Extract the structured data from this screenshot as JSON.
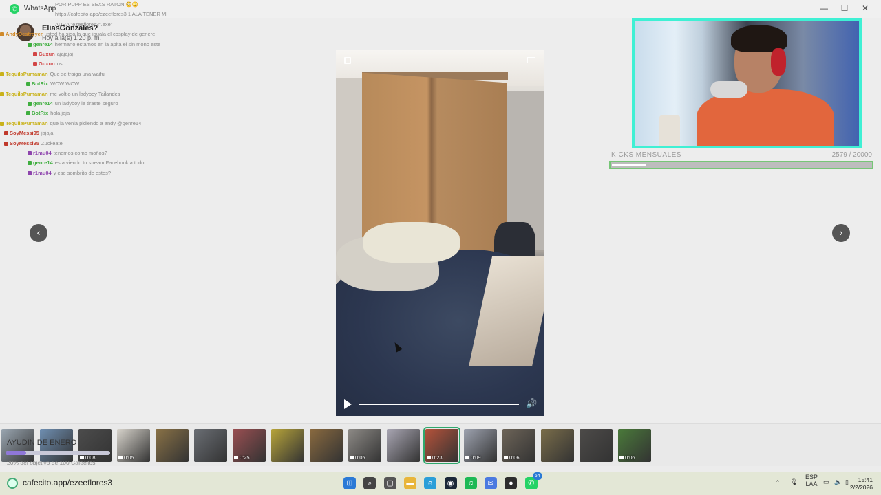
{
  "app": {
    "title": "WhatsApp"
  },
  "window": {
    "minimize": "—",
    "maximize": "☐",
    "close": "✕"
  },
  "contact": {
    "name": "EliasGonzales?",
    "time": "Hoy a la(s) 1:20 p. m."
  },
  "navigation": {
    "prev": "‹",
    "next": "›"
  },
  "kicks": {
    "label": "KICKS MENSUALES",
    "current": "2579",
    "goal": "/ 20000",
    "progress": 0.129
  },
  "chat": [
    {
      "user": "",
      "text": "POR PUPP ES SEXS RATON 😳😳",
      "color": "#9a9a9a"
    },
    {
      "user": "",
      "text": "https://cafecito.app/ezeeflores3 1 ALA TENER MI",
      "color": "#9a9a9a"
    },
    {
      "user": "",
      "text": "AURA \"ezeeflores3\".exe\"",
      "color": "#9a9a9a"
    },
    {
      "user": "AndyDestroyer",
      "text": "usted ha sido la que iguala el cosplay de genere",
      "color": "#d08a2a"
    },
    {
      "user": "genre14",
      "text": "hermano estamos en la apita el sin mono este",
      "color": "#3fae3f"
    },
    {
      "user": "Guxun",
      "text": "ajajajaj",
      "color": "#d24545"
    },
    {
      "user": "Guxun",
      "text": "osi",
      "color": "#d24545"
    },
    {
      "user": "TequilaPumaman",
      "text": "Que se traiga una waifu",
      "color": "#c9b21a"
    },
    {
      "user": "BotRix",
      "text": "WOW WOW",
      "color": "#3fae3f"
    },
    {
      "user": "TequilaPumaman",
      "text": "me voltio un ladyboy Tailandes",
      "color": "#c9b21a"
    },
    {
      "user": "genre14",
      "text": "un ladyboy le tiraste seguro",
      "color": "#3fae3f"
    },
    {
      "user": "BotRix",
      "text": "hola jaja",
      "color": "#3fae3f"
    },
    {
      "user": "TequilaPumaman",
      "text": "que la venia pidiendo a andy @genre14",
      "color": "#c9b21a"
    },
    {
      "user": "SoyMessi95",
      "text": "jajaja",
      "color": "#c0392b"
    },
    {
      "user": "SoyMessi95",
      "text": "Zuckeate",
      "color": "#c0392b"
    },
    {
      "user": "r1mu04",
      "text": "tenemos como moños?",
      "color": "#8e44ad"
    },
    {
      "user": "genre14",
      "text": "esta viendo tu stream Facebook a todo",
      "color": "#3fae3f"
    },
    {
      "user": "r1mu04",
      "text": "y ese sombrito de estos?",
      "color": "#8e44ad"
    }
  ],
  "thumbnails": [
    {
      "duration": "",
      "color": "#9aa6b1"
    },
    {
      "duration": "",
      "color": "#6f8fb2"
    },
    {
      "duration": "0:08",
      "color": "#4c4c4c"
    },
    {
      "duration": "0:05",
      "color": "#d8d4cc"
    },
    {
      "duration": "",
      "color": "#8a7246"
    },
    {
      "duration": "",
      "color": "#6a6e74"
    },
    {
      "duration": "0:25",
      "color": "#9a4f52"
    },
    {
      "duration": "",
      "color": "#b7a43a"
    },
    {
      "duration": "",
      "color": "#8a6a3f"
    },
    {
      "duration": "0:05",
      "color": "#8d8a86"
    },
    {
      "duration": "",
      "color": "#a9a6b3"
    },
    {
      "duration": "0:23",
      "color": "#b4523a",
      "selected": true
    },
    {
      "duration": "0:09",
      "color": "#9ea3b0"
    },
    {
      "duration": "0:06",
      "color": "#6d6458"
    },
    {
      "duration": "",
      "color": "#7a6d4a"
    },
    {
      "duration": "",
      "color": "#4d4b49"
    },
    {
      "duration": "0:06",
      "color": "#4a7a3a"
    }
  ],
  "ayudin": {
    "title": "AYUDIN DE ENERO",
    "subtitle": "20% del objetivo de 100 Cafecitos",
    "progress": 0.2
  },
  "taskbar": {
    "url": "cafecito.app/ezeeflores3",
    "lang_top": "ESP",
    "lang_bottom": "LAA",
    "time": "15:41",
    "date": "2/2/2026",
    "badge": "64",
    "apps": [
      {
        "name": "windows-start-icon",
        "glyph": "⊞",
        "color": "#2b7ad6"
      },
      {
        "name": "search-icon",
        "glyph": "⌕",
        "color": "#444444"
      },
      {
        "name": "task-view-icon",
        "glyph": "▢",
        "color": "#555555"
      },
      {
        "name": "file-explorer-icon",
        "glyph": "▬",
        "color": "#e8b63a"
      },
      {
        "name": "edge-icon",
        "glyph": "e",
        "color": "#2a9fd8"
      },
      {
        "name": "steam-icon",
        "glyph": "◉",
        "color": "#1b2838"
      },
      {
        "name": "spotify-icon",
        "glyph": "♫",
        "color": "#1db954"
      },
      {
        "name": "messenger-icon",
        "glyph": "✉",
        "color": "#4a7ae0"
      },
      {
        "name": "obs-icon",
        "glyph": "●",
        "color": "#2d2d2d"
      },
      {
        "name": "whatsapp-icon",
        "glyph": "✆",
        "color": "#25d366"
      }
    ]
  }
}
